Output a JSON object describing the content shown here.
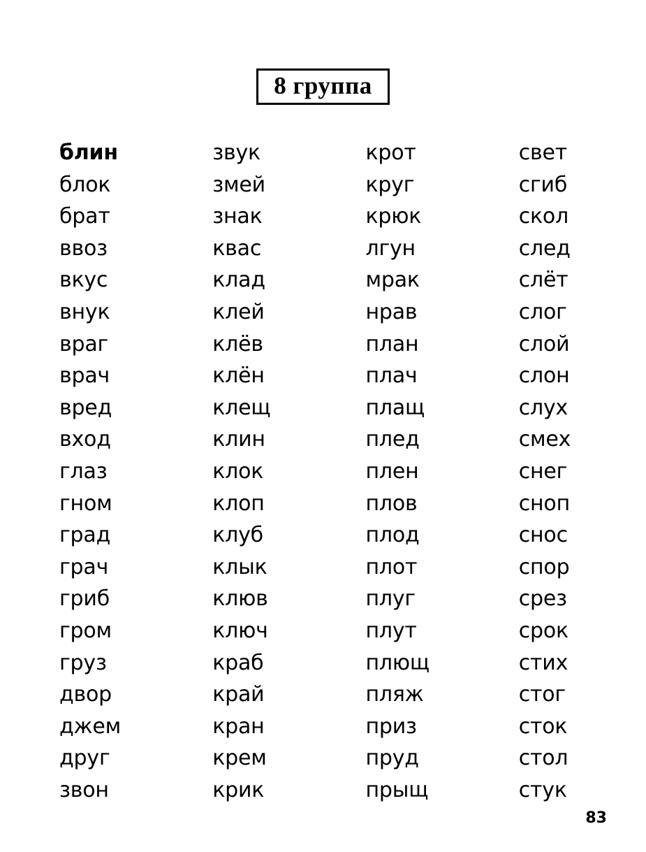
{
  "page": {
    "title": "8 группа",
    "page_number": "83",
    "background_color": "#ffffff",
    "text_color": "#000000"
  },
  "columns": [
    {
      "id": "column-1",
      "words": [
        {
          "text": "блин",
          "bold": true
        },
        {
          "text": "блок",
          "bold": false
        },
        {
          "text": "брат",
          "bold": false
        },
        {
          "text": "ввоз",
          "bold": false
        },
        {
          "text": "вкус",
          "bold": false
        },
        {
          "text": "внук",
          "bold": false
        },
        {
          "text": "враг",
          "bold": false
        },
        {
          "text": "врач",
          "bold": false
        },
        {
          "text": "вред",
          "bold": false
        },
        {
          "text": "вход",
          "bold": false
        },
        {
          "text": "глаз",
          "bold": false
        },
        {
          "text": "гном",
          "bold": false
        },
        {
          "text": "град",
          "bold": false
        },
        {
          "text": "грач",
          "bold": false
        },
        {
          "text": "гриб",
          "bold": false
        },
        {
          "text": "гром",
          "bold": false
        },
        {
          "text": "груз",
          "bold": false
        },
        {
          "text": "двор",
          "bold": false
        },
        {
          "text": "джем",
          "bold": false
        },
        {
          "text": "друг",
          "bold": false
        },
        {
          "text": "звон",
          "bold": false
        }
      ]
    },
    {
      "id": "column-2",
      "words": [
        {
          "text": "звук",
          "bold": false
        },
        {
          "text": "змей",
          "bold": false
        },
        {
          "text": "знак",
          "bold": false
        },
        {
          "text": "квас",
          "bold": false
        },
        {
          "text": "клад",
          "bold": false
        },
        {
          "text": "клей",
          "bold": false
        },
        {
          "text": "клёв",
          "bold": false
        },
        {
          "text": "клён",
          "bold": false
        },
        {
          "text": "клещ",
          "bold": false
        },
        {
          "text": "клин",
          "bold": false
        },
        {
          "text": "клок",
          "bold": false
        },
        {
          "text": "клоп",
          "bold": false
        },
        {
          "text": "клуб",
          "bold": false
        },
        {
          "text": "клык",
          "bold": false
        },
        {
          "text": "клюв",
          "bold": false
        },
        {
          "text": "ключ",
          "bold": false
        },
        {
          "text": "краб",
          "bold": false
        },
        {
          "text": "край",
          "bold": false
        },
        {
          "text": "кран",
          "bold": false
        },
        {
          "text": "крем",
          "bold": false
        },
        {
          "text": "крик",
          "bold": false
        }
      ]
    },
    {
      "id": "column-3",
      "words": [
        {
          "text": "крот",
          "bold": false
        },
        {
          "text": "круг",
          "bold": false
        },
        {
          "text": "крюк",
          "bold": false
        },
        {
          "text": "лгун",
          "bold": false
        },
        {
          "text": "мрак",
          "bold": false
        },
        {
          "text": "нрав",
          "bold": false
        },
        {
          "text": "план",
          "bold": false
        },
        {
          "text": "плач",
          "bold": false
        },
        {
          "text": "плащ",
          "bold": false
        },
        {
          "text": "плед",
          "bold": false
        },
        {
          "text": "плен",
          "bold": false
        },
        {
          "text": "плов",
          "bold": false
        },
        {
          "text": "плод",
          "bold": false
        },
        {
          "text": "плот",
          "bold": false
        },
        {
          "text": "плуг",
          "bold": false
        },
        {
          "text": "плут",
          "bold": false
        },
        {
          "text": "плющ",
          "bold": false
        },
        {
          "text": "пляж",
          "bold": false
        },
        {
          "text": "приз",
          "bold": false
        },
        {
          "text": "пруд",
          "bold": false
        },
        {
          "text": "прыщ",
          "bold": false
        }
      ]
    },
    {
      "id": "column-4",
      "words": [
        {
          "text": "свет",
          "bold": false
        },
        {
          "text": "сгиб",
          "bold": false
        },
        {
          "text": "скол",
          "bold": false
        },
        {
          "text": "след",
          "bold": false
        },
        {
          "text": "слёт",
          "bold": false
        },
        {
          "text": "слог",
          "bold": false
        },
        {
          "text": "слой",
          "bold": false
        },
        {
          "text": "слон",
          "bold": false
        },
        {
          "text": "слух",
          "bold": false
        },
        {
          "text": "смех",
          "bold": false
        },
        {
          "text": "снег",
          "bold": false
        },
        {
          "text": "сноп",
          "bold": false
        },
        {
          "text": "снос",
          "bold": false
        },
        {
          "text": "спор",
          "bold": false
        },
        {
          "text": "срез",
          "bold": false
        },
        {
          "text": "срок",
          "bold": false
        },
        {
          "text": "стих",
          "bold": false
        },
        {
          "text": "стог",
          "bold": false
        },
        {
          "text": "сток",
          "bold": false
        },
        {
          "text": "стол",
          "bold": false
        },
        {
          "text": "стук",
          "bold": false
        }
      ]
    }
  ]
}
